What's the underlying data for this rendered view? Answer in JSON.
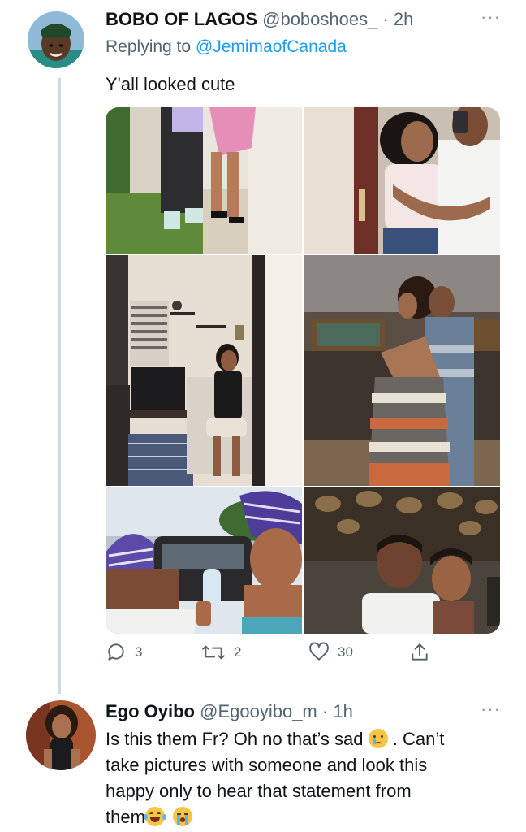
{
  "tweet1": {
    "display_name": "BOBO OF LAGOS",
    "handle": "@boboshoes_",
    "separator": "·",
    "time": "2h",
    "more": "···",
    "replying_label": "Replying to",
    "replying_to": "@JemimaofCanada",
    "text": "Y'all looked cute",
    "photos": [
      {
        "description": "couple-feet-photo"
      },
      {
        "description": "couple-mirror-selfie"
      },
      {
        "description": "woman-bedroom-mirror-selfie"
      },
      {
        "description": "couple-hug"
      },
      {
        "description": "couple-traditional-outfits"
      },
      {
        "description": "couple-restaurant"
      }
    ],
    "actions": {
      "reply_count": "3",
      "retweet_count": "2",
      "like_count": "30"
    }
  },
  "tweet2": {
    "display_name": "Ego Oyibo",
    "handle": "@Egooyibo_m",
    "separator": "·",
    "time": "1h",
    "more": "···",
    "text_part1": "Is this them Fr? Oh no that’s sad",
    "text_part2": ". Can’t",
    "text_line2": "take pictures with someone and look this",
    "text_line3": "happy only to hear that statement from",
    "text_line4": "them"
  },
  "colors": {
    "accent": "#1d9bf0",
    "secondary_text": "#536471",
    "thread_line": "#cfd9de"
  }
}
